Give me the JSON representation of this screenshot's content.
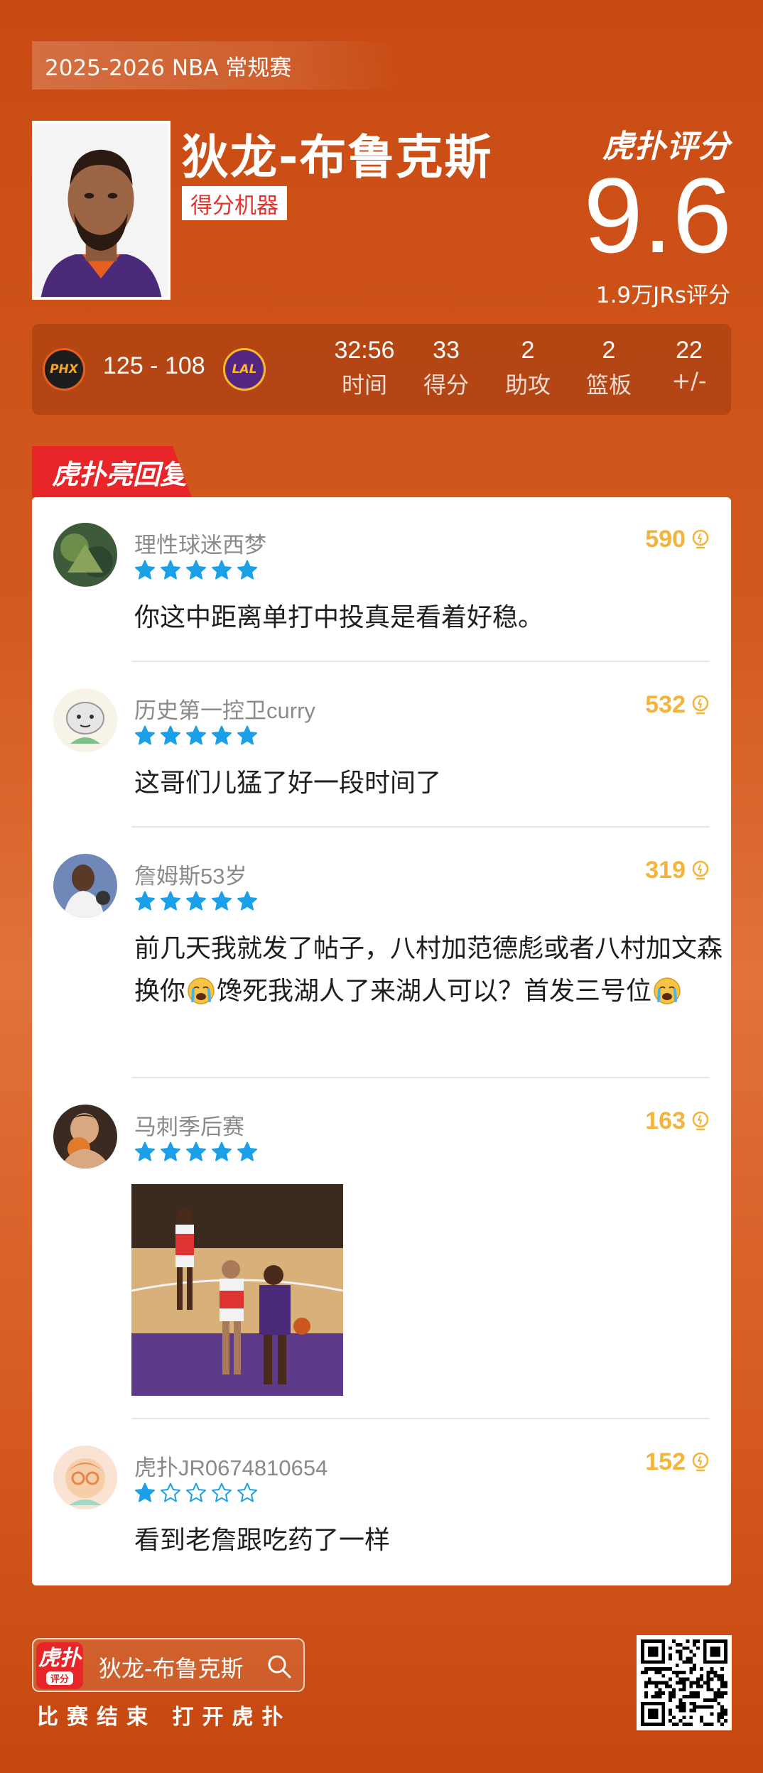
{
  "header": {
    "season": "2025-2026 NBA 常规赛"
  },
  "player": {
    "name": "狄龙-布鲁克斯",
    "tag": "得分机器"
  },
  "rating": {
    "logo": "虎扑评分",
    "score": "9.6",
    "count": "1.9万JRs评分"
  },
  "game": {
    "home_team_logo": "PHX",
    "away_team_logo": "LAL",
    "score": "125 - 108",
    "stats": [
      {
        "value": "32:56",
        "label": "时间"
      },
      {
        "value": "33",
        "label": "得分"
      },
      {
        "value": "2",
        "label": "助攻"
      },
      {
        "value": "2",
        "label": "篮板"
      },
      {
        "value": "22",
        "label": "+/-"
      }
    ]
  },
  "section": {
    "title": "虎扑亮回复"
  },
  "comments": [
    {
      "user": "理性球迷西梦",
      "likes": "590",
      "rating": 5,
      "text": "你这中距离单打中投真是看着好稳。"
    },
    {
      "user": "历史第一控卫curry",
      "likes": "532",
      "rating": 5,
      "text": "这哥们儿猛了好一段时间了"
    },
    {
      "user": "詹姆斯53岁",
      "likes": "319",
      "rating": 5,
      "text_parts": [
        "前几天我就发了帖子，八村加范德彪或者八村加文森换你",
        "馋死我湖人了来湖人可以？首发三号位",
        ""
      ]
    },
    {
      "user": "马刺季后赛",
      "likes": "163",
      "rating": 5
    },
    {
      "user": "虎扑JR0674810654",
      "likes": "152",
      "rating": 1,
      "text": "看到老詹跟吃药了一样"
    }
  ],
  "footer": {
    "app_icon_label": "虎扑",
    "app_icon_sub": "评分",
    "search_text": "狄龙-布鲁克斯",
    "slogan": "比赛结束 打开虎扑"
  },
  "colors": {
    "background": "#d35a1f",
    "accent_red": "#e8262a",
    "likes": "#f4b33a",
    "star": "#1aa0e8"
  }
}
